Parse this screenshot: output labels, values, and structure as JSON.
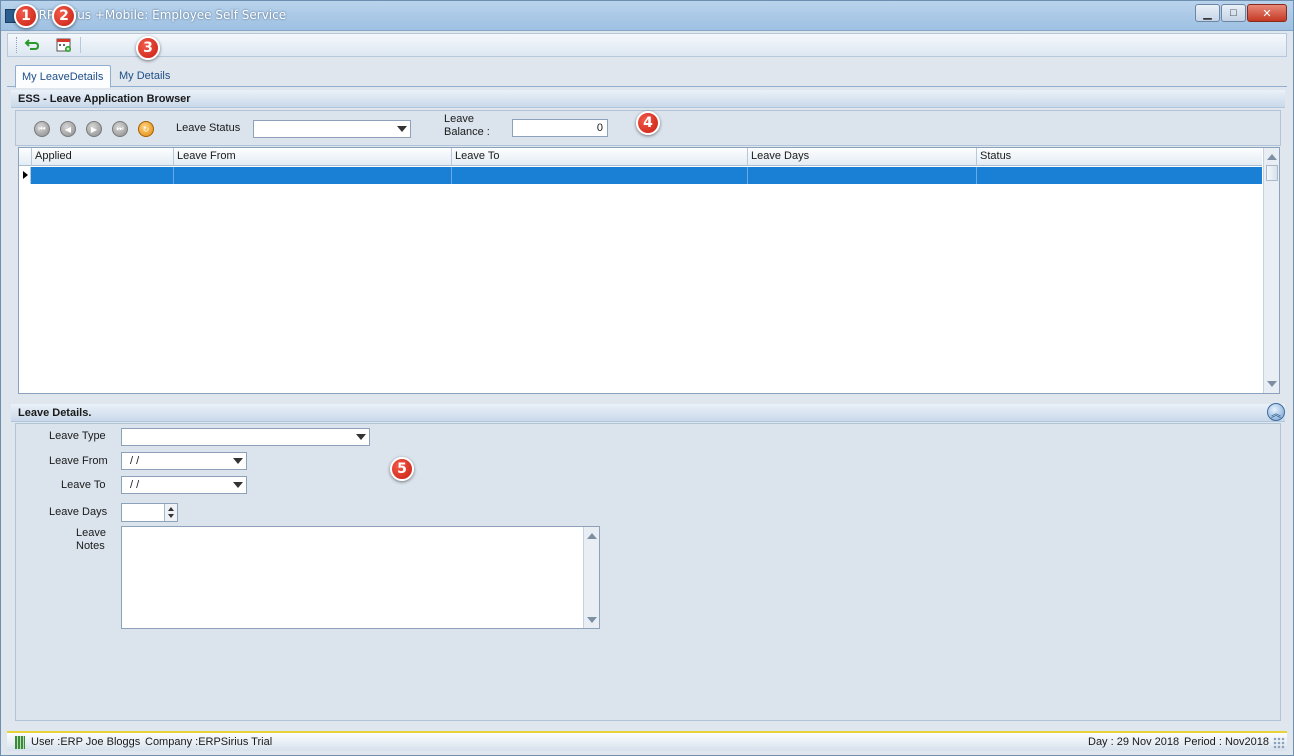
{
  "window": {
    "title": "ERP Sirius +Mobile: Employee Self Service",
    "minimize_label": "▁",
    "maximize_label": "□",
    "close_label": "✕"
  },
  "annotations": [
    "1",
    "2",
    "3",
    "4",
    "5"
  ],
  "tabs": [
    {
      "label": "My LeaveDetails",
      "active": true
    },
    {
      "label": "My Details",
      "active": false
    }
  ],
  "browser": {
    "header": "ESS - Leave Application Browser",
    "leave_status_label": "Leave Status",
    "leave_status_value": "",
    "leave_balance_label_line1": "Leave",
    "leave_balance_label_line2": "Balance :",
    "leave_balance_value": "0",
    "columns": [
      "Applied",
      "Leave From",
      "Leave To",
      "Leave Days",
      "Status"
    ],
    "rows": [
      [
        "",
        "",
        "",
        "",
        ""
      ]
    ]
  },
  "details": {
    "header": "Leave Details.",
    "leave_type_label": "Leave Type",
    "leave_type_value": "",
    "leave_from_label": "Leave From",
    "leave_from_value": "/ /",
    "leave_to_label": "Leave To",
    "leave_to_value": "/ /",
    "leave_days_label": "Leave Days",
    "leave_days_value": "",
    "leave_notes_label_line1": "Leave",
    "leave_notes_label_line2": "Notes",
    "leave_notes_value": ""
  },
  "statusbar": {
    "user": "User :ERP Joe Bloggs",
    "company": "Company :ERPSirius Trial",
    "day": "Day : 29 Nov 2018",
    "period": "Period : Nov2018"
  },
  "colors": {
    "selected_row": "#1a80d6",
    "badge": "#d42a1a",
    "status_accent": "#e7d23a"
  }
}
